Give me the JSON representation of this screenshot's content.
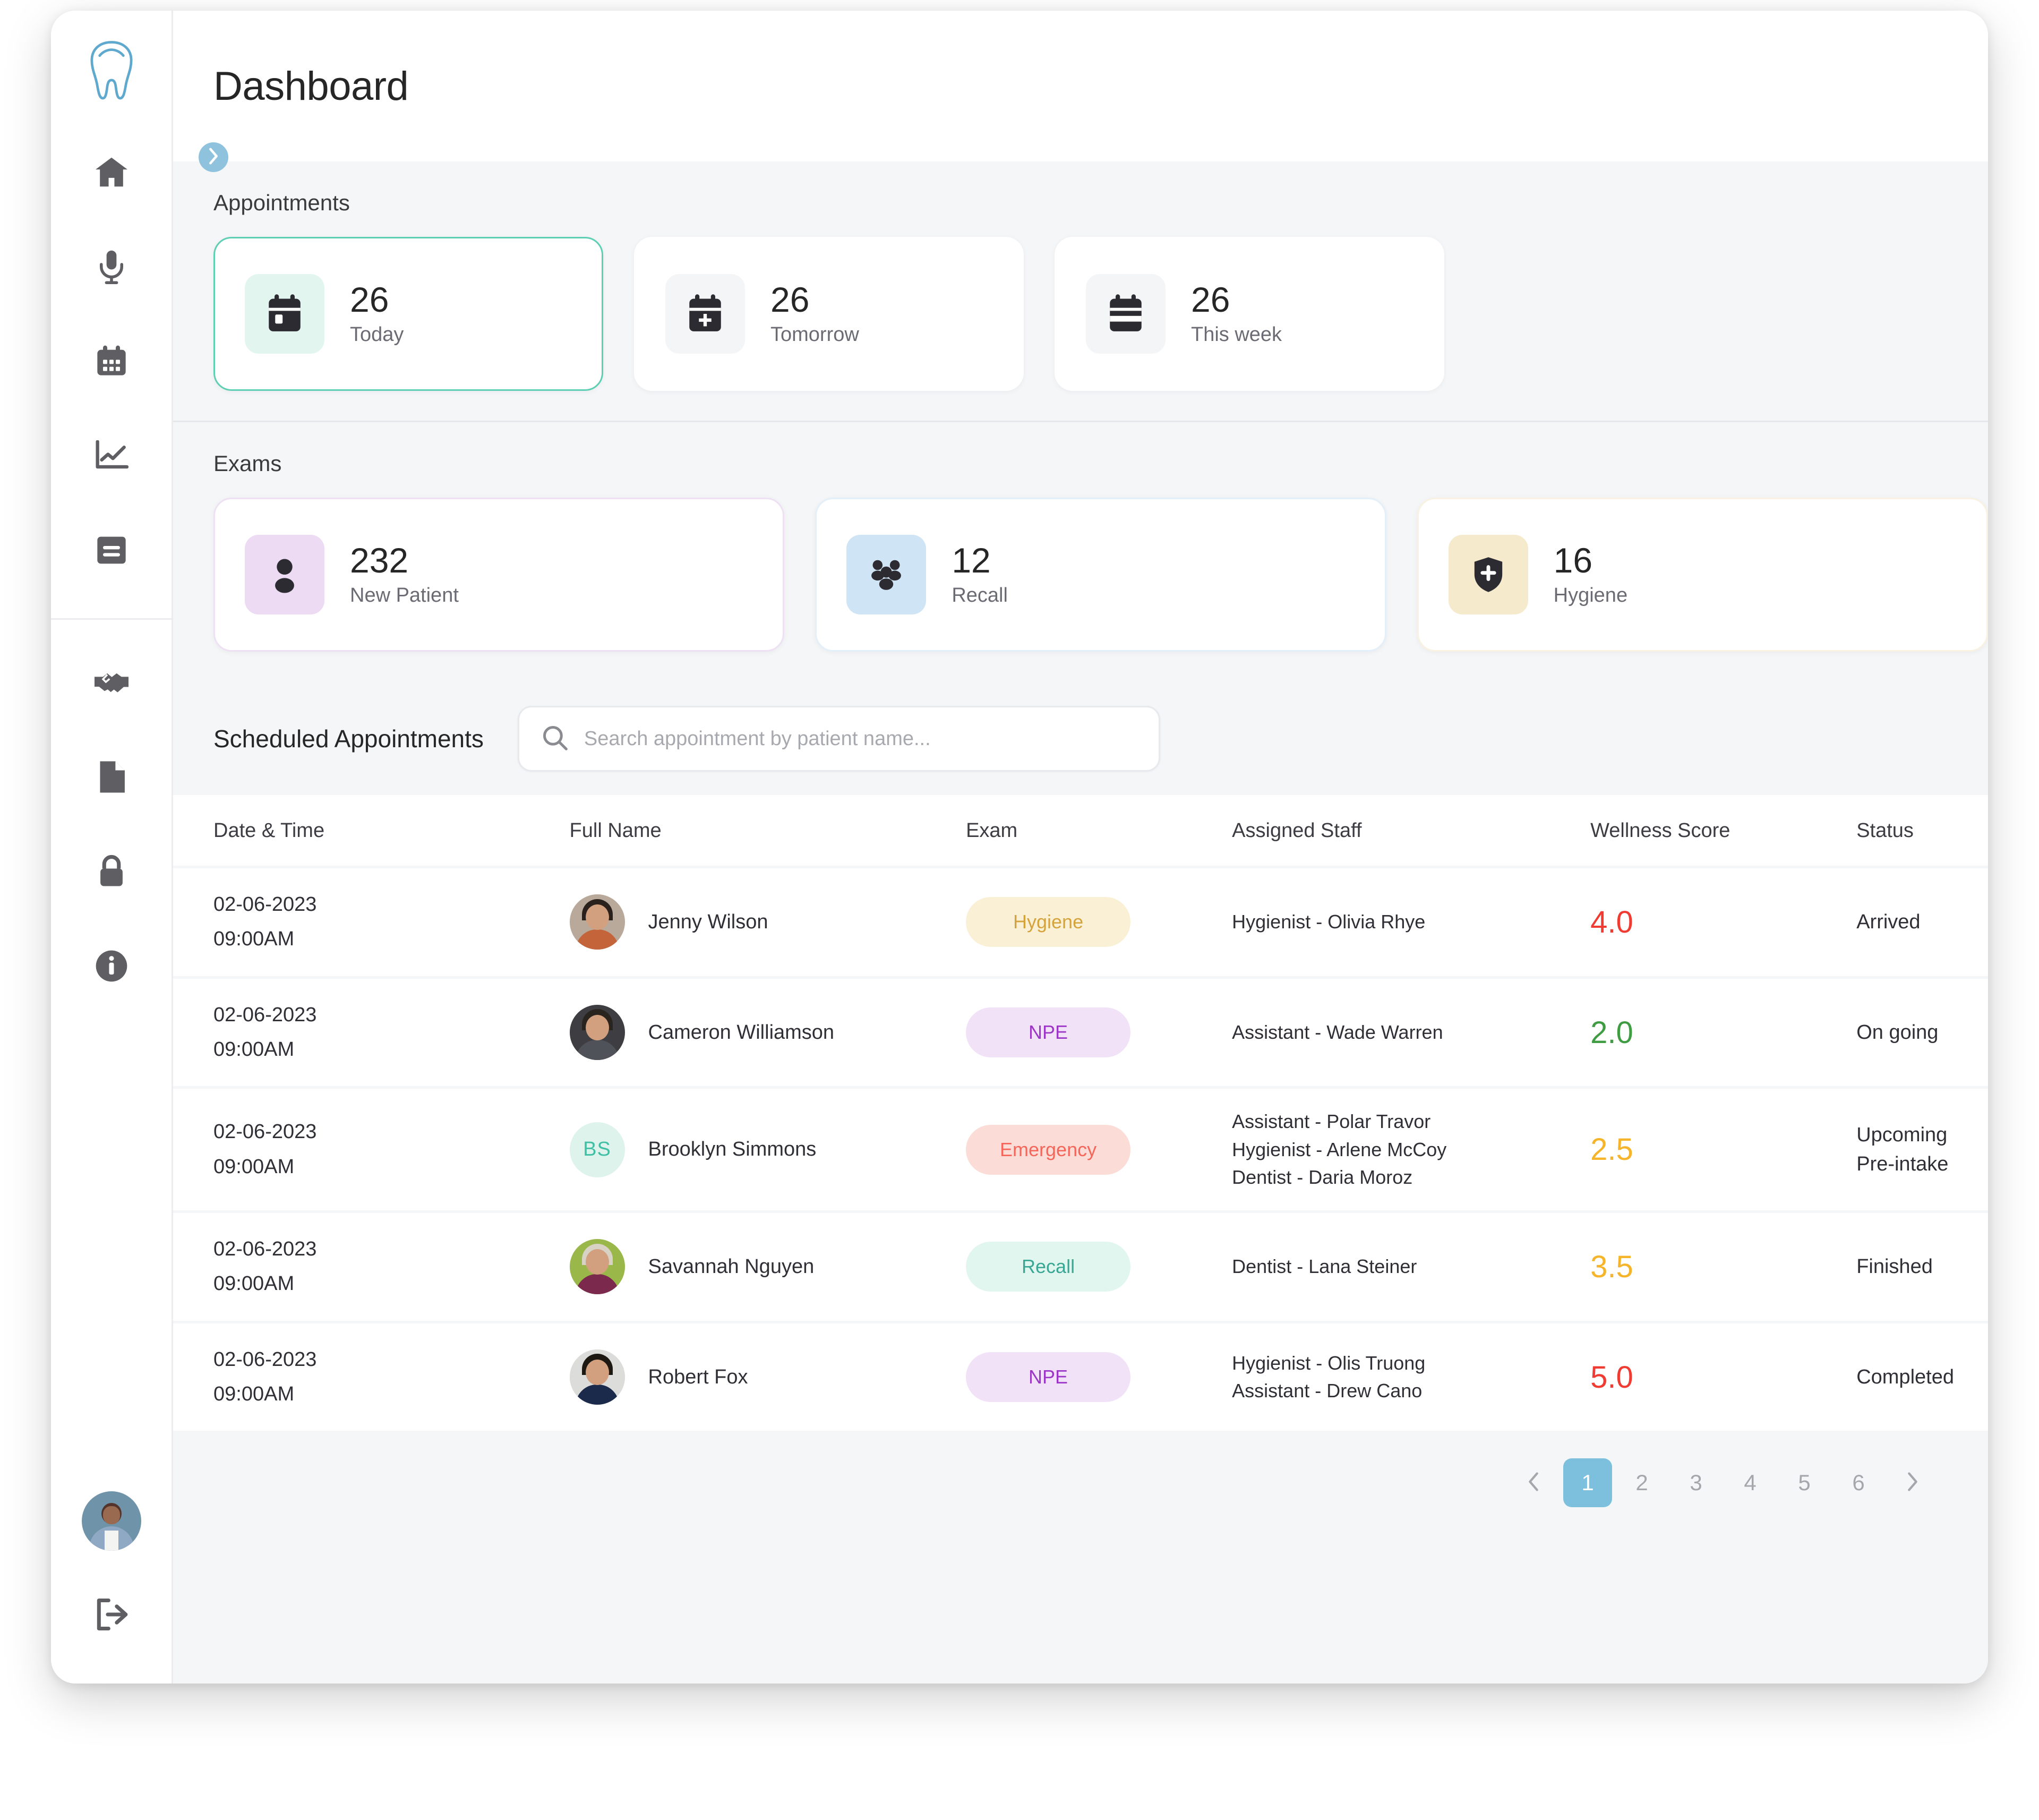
{
  "header": {
    "title": "Dashboard"
  },
  "sidebar": {
    "logo_name": "tooth-logo",
    "items": [
      {
        "icon": "home-icon"
      },
      {
        "icon": "microphone-icon"
      },
      {
        "icon": "calendar-icon"
      },
      {
        "icon": "analytics-chart-icon"
      },
      {
        "icon": "book-icon"
      },
      {
        "icon": "handshake-icon"
      },
      {
        "icon": "document-icon"
      },
      {
        "icon": "lock-icon"
      },
      {
        "icon": "info-icon"
      }
    ],
    "avatar": "user-avatar",
    "logout": "logout-icon",
    "collapse": "chevron-right-icon"
  },
  "appointments": {
    "label": "Appointments",
    "cards": [
      {
        "value": "26",
        "label": "Today",
        "icon": "calendar-day-icon",
        "active": true
      },
      {
        "value": "26",
        "label": "Tomorrow",
        "icon": "calendar-plus-icon",
        "active": false
      },
      {
        "value": "26",
        "label": "This week",
        "icon": "calendar-week-icon",
        "active": false
      }
    ]
  },
  "exams": {
    "label": "Exams",
    "cards": [
      {
        "value": "232",
        "label": "New Patient",
        "icon": "person-icon"
      },
      {
        "value": "12",
        "label": "Recall",
        "icon": "people-group-icon"
      },
      {
        "value": "16",
        "label": "Hygiene",
        "icon": "shield-cross-icon"
      }
    ]
  },
  "table": {
    "title": "Scheduled Appointments",
    "search_placeholder": "Search appointment by patient name...",
    "search_value": "",
    "columns": [
      "Date & Time",
      "Full Name",
      "Exam",
      "Assigned Staff",
      "Wellness Score",
      "Status"
    ],
    "rows": [
      {
        "date": "02-06-2023",
        "time": "09:00AM",
        "name": "Jenny Wilson",
        "avatar_type": "photo",
        "exam": "Hygiene",
        "exam_style": "hygiene",
        "staff": [
          "Hygienist - Olivia Rhye"
        ],
        "score": "4.0",
        "score_color": "#ef3b32",
        "status": [
          "Arrived"
        ]
      },
      {
        "date": "02-06-2023",
        "time": "09:00AM",
        "name": "Cameron Williamson",
        "avatar_type": "photo",
        "exam": "NPE",
        "exam_style": "npe",
        "staff": [
          "Assistant - Wade Warren"
        ],
        "score": "2.0",
        "score_color": "#3f9c43",
        "status": [
          "On going"
        ]
      },
      {
        "date": "02-06-2023",
        "time": "09:00AM",
        "name": "Brooklyn Simmons",
        "avatar_type": "initials",
        "initials": "BS",
        "exam": "Emergency",
        "exam_style": "emergency",
        "staff": [
          "Assistant - Polar Travor",
          "Hygienist - Arlene McCoy",
          "Dentist - Daria Moroz"
        ],
        "score": "2.5",
        "score_color": "#f5b429",
        "status": [
          "Upcoming",
          "Pre-intake"
        ]
      },
      {
        "date": "02-06-2023",
        "time": "09:00AM",
        "name": "Savannah Nguyen",
        "avatar_type": "photo",
        "exam": "Recall",
        "exam_style": "recall",
        "staff": [
          "Dentist - Lana Steiner"
        ],
        "score": "3.5",
        "score_color": "#f5b429",
        "status": [
          "Finished"
        ]
      },
      {
        "date": "02-06-2023",
        "time": "09:00AM",
        "name": "Robert Fox",
        "avatar_type": "photo",
        "exam": "NPE",
        "exam_style": "npe",
        "staff": [
          "Hygienist - Olis Truong",
          "Assistant - Drew Cano"
        ],
        "score": "5.0",
        "score_color": "#ef3b32",
        "status": [
          "Completed"
        ]
      }
    ]
  },
  "pagination": {
    "prev": "chevron-left-icon",
    "next": "chevron-right-icon",
    "pages": [
      "1",
      "2",
      "3",
      "4",
      "5",
      "6"
    ],
    "current": "1"
  },
  "colors": {
    "accent_teal": "#5fcfb4",
    "accent_blue": "#7cc0dd",
    "logo_blue": "#5fa8ce",
    "page_bg": "#f5f6f8"
  }
}
